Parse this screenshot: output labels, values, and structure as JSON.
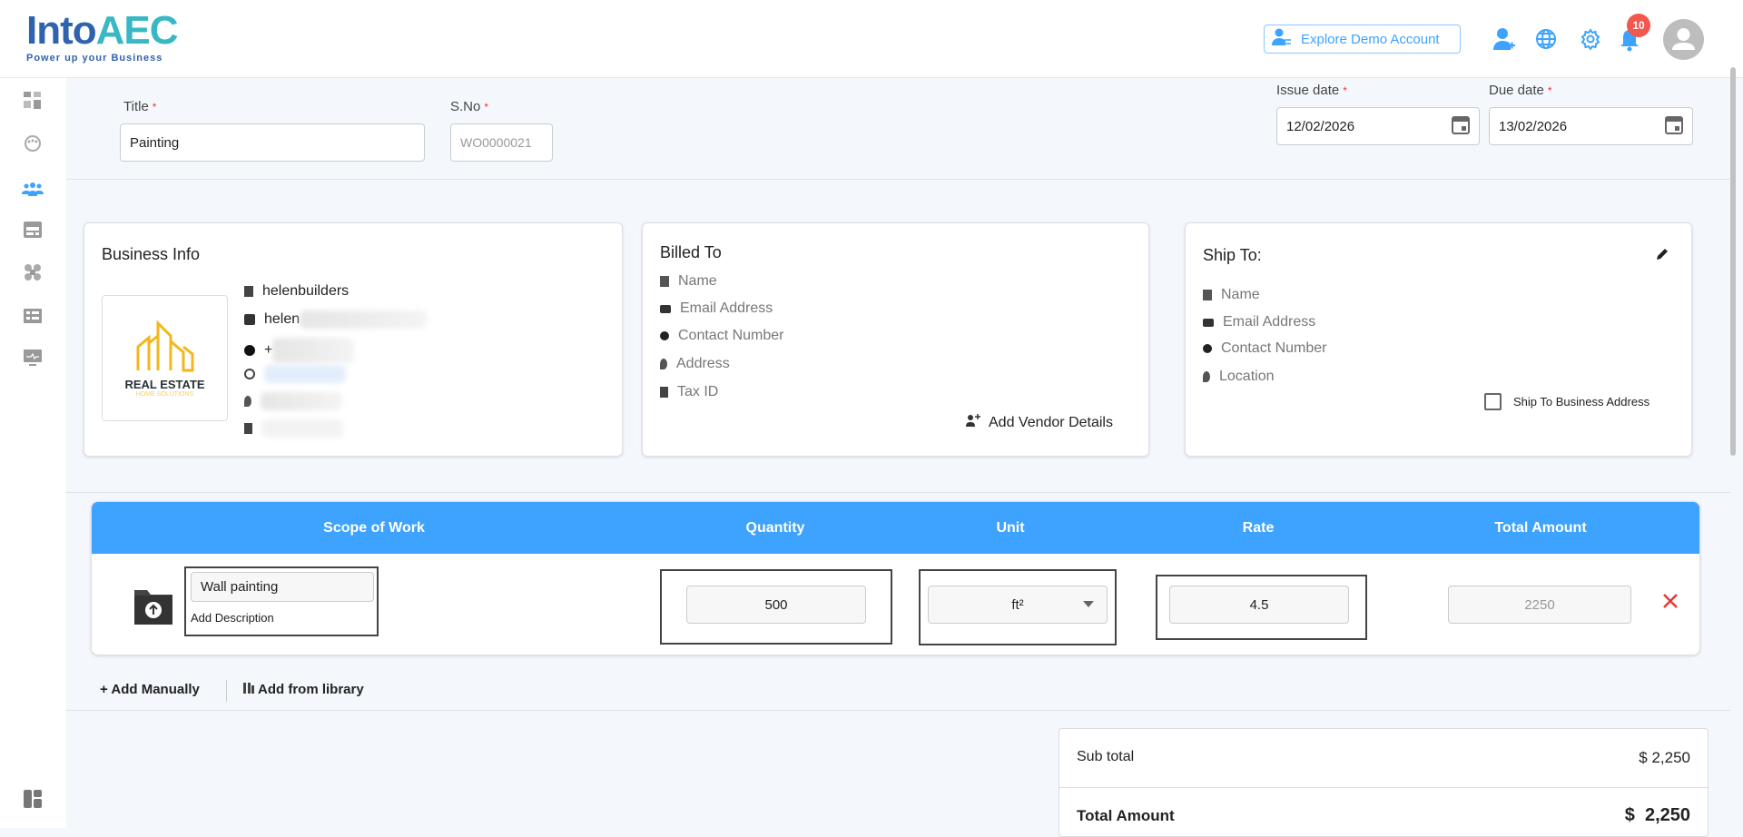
{
  "brand": {
    "name_part1": "Into",
    "name_part2": "AEC",
    "tagline": "Power up your Business"
  },
  "header": {
    "explore_label": "Explore Demo Account",
    "notification_count": "10"
  },
  "form": {
    "title_label": "Title",
    "title_value": "Painting",
    "sno_label": "S.No",
    "sno_value": "WO0000021",
    "issue_label": "Issue date",
    "issue_value": "12/02/2026",
    "due_label": "Due date",
    "due_value": "13/02/2026"
  },
  "business": {
    "title": "Business Info",
    "name": "helenbuilders",
    "email_visible": "helen",
    "phone_visible": "+",
    "logo_text": "REAL ESTATE",
    "logo_sub": "HOME SOLUTIONS"
  },
  "billed": {
    "title": "Billed To",
    "fields": [
      "Name",
      "Email Address",
      "Contact Number",
      "Address",
      "Tax ID"
    ],
    "add_vendor": "Add Vendor Details"
  },
  "ship": {
    "title": "Ship To:",
    "fields": [
      "Name",
      "Email Address",
      "Contact Number",
      "Location"
    ],
    "checkbox_label": "Ship To Business Address"
  },
  "table": {
    "headers": [
      "Scope of Work",
      "Quantity",
      "Unit",
      "Rate",
      "Total Amount"
    ],
    "rows": [
      {
        "scope": "Wall painting",
        "add_description": "Add Description",
        "quantity": "500",
        "unit": "ft²",
        "rate": "4.5",
        "total": "2250"
      }
    ]
  },
  "actions": {
    "add_manually": "+ Add Manually",
    "add_library": "Add from library"
  },
  "totals": {
    "subtotal_label": "Sub total",
    "subtotal_value": "$ 2,250",
    "total_label": "Total Amount",
    "total_value": "$  2,250"
  },
  "colors": {
    "accent": "#3ea2ff",
    "danger": "#e53935"
  }
}
